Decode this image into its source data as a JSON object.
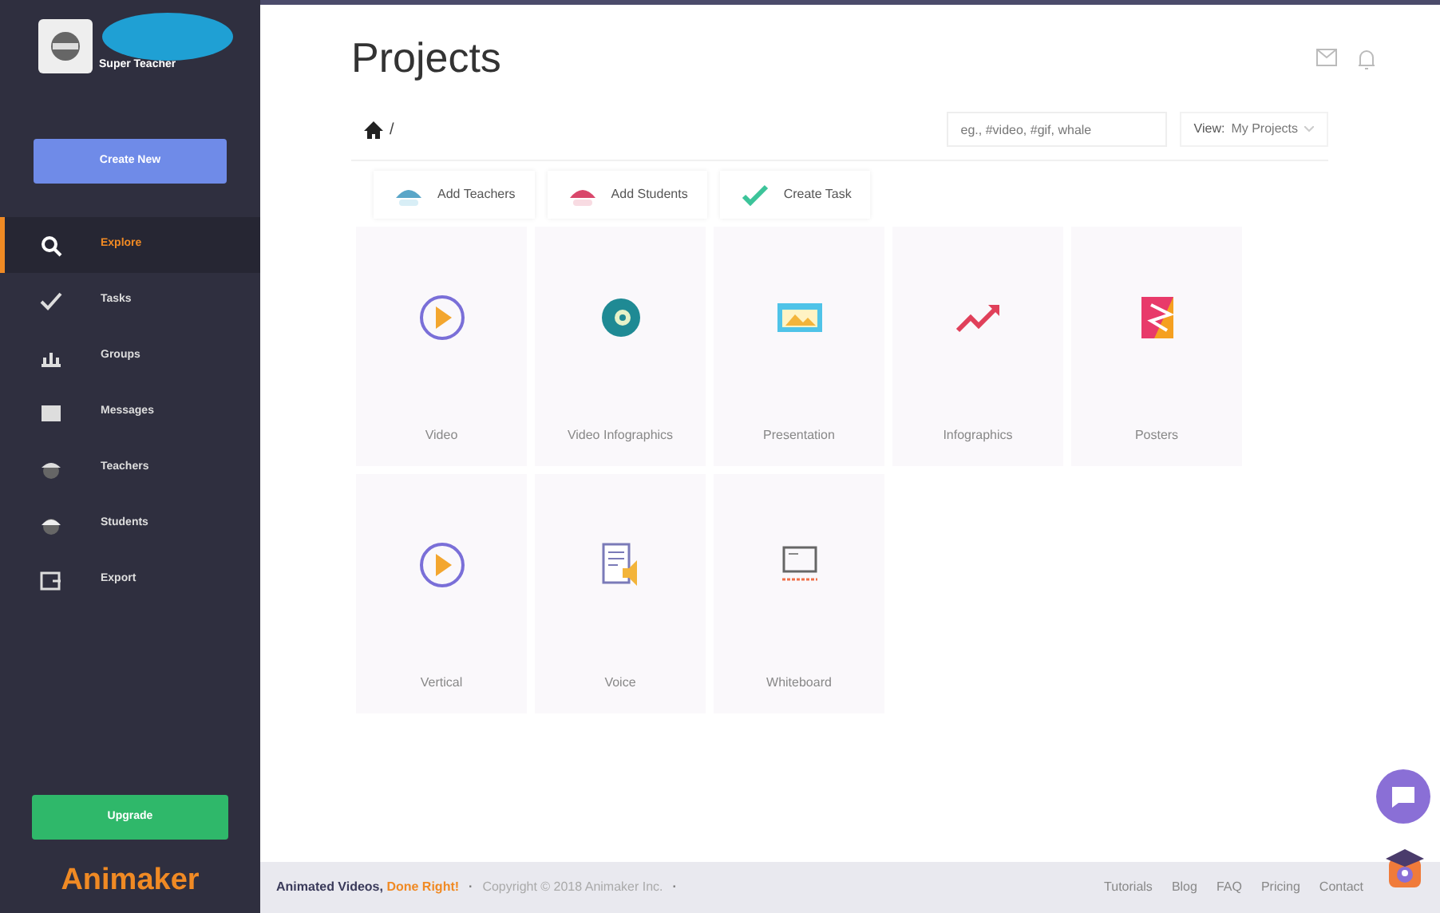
{
  "sidebar": {
    "user": "Super Teacher",
    "create_button": "Create New",
    "items": [
      {
        "label": "Explore",
        "kind": "search",
        "selected": true
      },
      {
        "label": "Tasks",
        "kind": "check",
        "selected": false
      },
      {
        "label": "Groups",
        "kind": "groups",
        "selected": false
      },
      {
        "label": "Messages",
        "kind": "message",
        "selected": false
      },
      {
        "label": "Teachers",
        "kind": "teacher",
        "selected": false
      },
      {
        "label": "Students",
        "kind": "student",
        "selected": false
      },
      {
        "label": "Export",
        "kind": "export",
        "selected": false
      }
    ],
    "upgrade_button": "Upgrade",
    "logo": "Animaker"
  },
  "header": {
    "title": "Projects"
  },
  "breadcrumb": {
    "separator": "/"
  },
  "search": {
    "placeholder": "eg., #video, #gif, whale"
  },
  "view": {
    "label": "View:",
    "value": "My Projects"
  },
  "actions": [
    {
      "label": "Add Teachers",
      "kind": "teacher"
    },
    {
      "label": "Add Students",
      "kind": "student"
    },
    {
      "label": "Create Task",
      "kind": "check"
    }
  ],
  "tiles": [
    {
      "label": "Video",
      "kind": "play"
    },
    {
      "label": "Video Infographics",
      "kind": "vinfo"
    },
    {
      "label": "Presentation",
      "kind": "present"
    },
    {
      "label": "Infographics",
      "kind": "trend"
    },
    {
      "label": "Posters",
      "kind": "poster"
    },
    {
      "label": "Vertical",
      "kind": "play"
    },
    {
      "label": "Voice",
      "kind": "voice"
    },
    {
      "label": "Whiteboard",
      "kind": "board"
    }
  ],
  "footer": {
    "tagline": "Animated Videos, ",
    "tagline_highlight": "Done Right!",
    "separator_1": "·",
    "copyright": "Copyright © 2018 Animaker Inc.",
    "separator_2": "·",
    "links": [
      "Tutorials",
      "Blog",
      "FAQ",
      "Pricing",
      "Contact"
    ]
  }
}
